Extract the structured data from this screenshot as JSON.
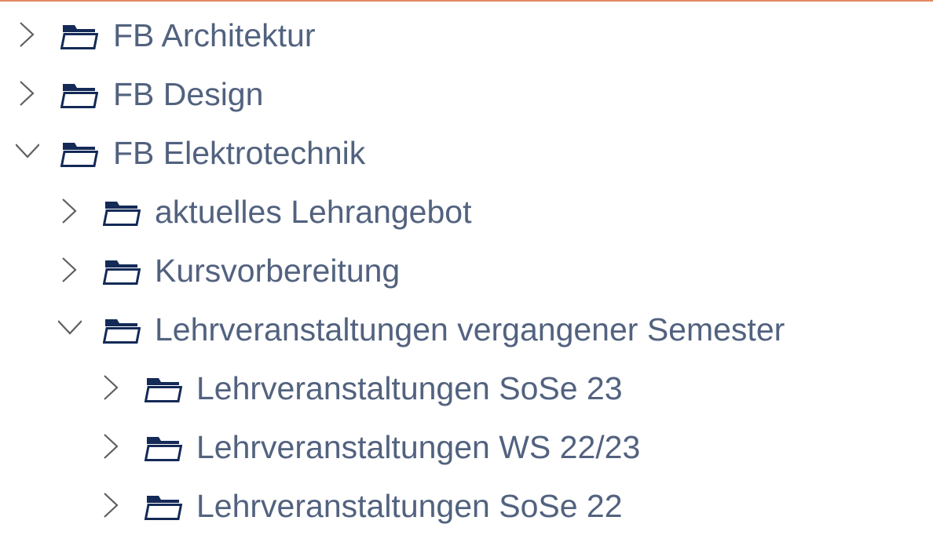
{
  "colors": {
    "text": "#52627f",
    "folder": "#142a57",
    "chevron": "#5f5f5f",
    "top_rule": "#e58a63"
  },
  "icons": {
    "collapsed": "chevron-right-icon",
    "expanded": "chevron-down-icon",
    "folder": "folder-icon"
  },
  "tree": {
    "items": [
      {
        "label": "FB Architektur",
        "expanded": false,
        "level": 0
      },
      {
        "label": "FB Design",
        "expanded": false,
        "level": 0
      },
      {
        "label": "FB Elektrotechnik",
        "expanded": true,
        "level": 0
      },
      {
        "label": "aktuelles Lehrangebot",
        "expanded": false,
        "level": 1
      },
      {
        "label": "Kursvorbereitung",
        "expanded": false,
        "level": 1
      },
      {
        "label": "Lehrveranstaltungen vergangener Semester",
        "expanded": true,
        "level": 1
      },
      {
        "label": "Lehrveranstaltungen SoSe 23",
        "expanded": false,
        "level": 2
      },
      {
        "label": "Lehrveranstaltungen WS 22/23",
        "expanded": false,
        "level": 2
      },
      {
        "label": "Lehrveranstaltungen SoSe 22",
        "expanded": false,
        "level": 2
      }
    ]
  }
}
